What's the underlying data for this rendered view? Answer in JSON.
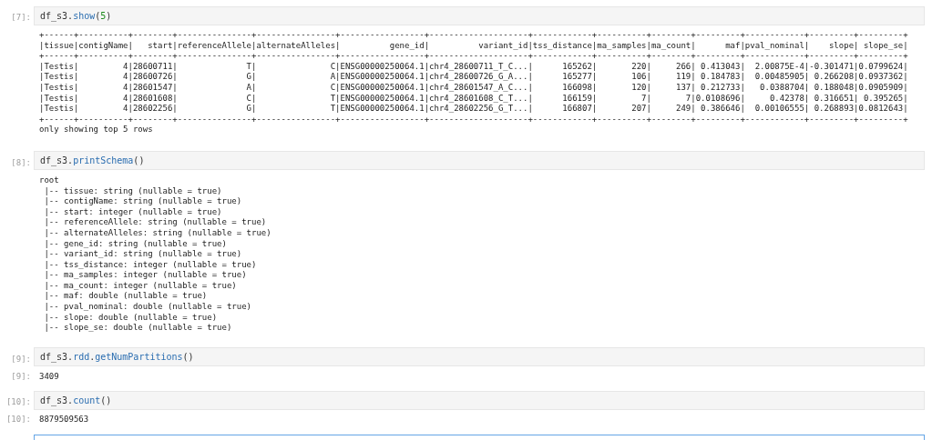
{
  "cells": [
    {
      "prompt": "[7]:",
      "code": [
        {
          "text": "df_s3.",
          "kind": "plain"
        },
        {
          "text": "show",
          "kind": "method"
        },
        {
          "text": "(",
          "kind": "plain"
        },
        {
          "text": "5",
          "kind": "number"
        },
        {
          "text": ")",
          "kind": "plain"
        }
      ],
      "output": [
        "+------+----------+--------+---------------+----------------+-----------------+--------------------+------------+----------+--------+---------+------------+---------+---------+",
        "|tissue|contigName|   start|referenceAllele|alternateAlleles|          gene_id|          variant_id|tss_distance|ma_samples|ma_count|      maf|pval_nominal|    slope| slope_se|",
        "+------+----------+--------+---------------+----------------+-----------------+--------------------+------------+----------+--------+---------+------------+---------+---------+",
        "|Testis|         4|28600711|              T|               C|ENSG00000250064.1|chr4_28600711_T_C...|      165262|       220|     266| 0.413043|  2.00875E-4|-0.301471|0.0799624|",
        "|Testis|         4|28600726|              G|               A|ENSG00000250064.1|chr4_28600726_G_A...|      165277|       106|     119| 0.184783|  0.00485905| 0.266208|0.0937362|",
        "|Testis|         4|28601547|              A|               C|ENSG00000250064.1|chr4_28601547_A_C...|      166098|       120|     137| 0.212733|   0.0388704| 0.188048|0.0905909|",
        "|Testis|         4|28601608|              C|               T|ENSG00000250064.1|chr4_28601608_C_T...|      166159|         7|       7|0.0108696|     0.42378| 0.316651| 0.395265|",
        "|Testis|         4|28602256|              G|               T|ENSG00000250064.1|chr4_28602256_G_T...|      166807|       207|     249| 0.386646|  0.00106555| 0.268893|0.0812643|",
        "+------+----------+--------+---------------+----------------+-----------------+--------------------+------------+----------+--------+---------+------------+---------+---------+",
        "only showing top 5 rows"
      ]
    },
    {
      "prompt": "[8]:",
      "code": [
        {
          "text": "df_s3.",
          "kind": "plain"
        },
        {
          "text": "printSchema",
          "kind": "method"
        },
        {
          "text": "()",
          "kind": "plain"
        }
      ],
      "output": [
        "root",
        " |-- tissue: string (nullable = true)",
        " |-- contigName: string (nullable = true)",
        " |-- start: integer (nullable = true)",
        " |-- referenceAllele: string (nullable = true)",
        " |-- alternateAlleles: string (nullable = true)",
        " |-- gene_id: string (nullable = true)",
        " |-- variant_id: string (nullable = true)",
        " |-- tss_distance: integer (nullable = true)",
        " |-- ma_samples: integer (nullable = true)",
        " |-- ma_count: integer (nullable = true)",
        " |-- maf: double (nullable = true)",
        " |-- pval_nominal: double (nullable = true)",
        " |-- slope: double (nullable = true)",
        " |-- slope_se: double (nullable = true)"
      ]
    },
    {
      "prompt": "[9]:",
      "code": [
        {
          "text": "df_s3.",
          "kind": "plain"
        },
        {
          "text": "rdd",
          "kind": "method"
        },
        {
          "text": ".",
          "kind": "plain"
        },
        {
          "text": "getNumPartitions",
          "kind": "method"
        },
        {
          "text": "()",
          "kind": "plain"
        }
      ],
      "output_prompt": "[9]:",
      "output": [
        "3409"
      ]
    },
    {
      "prompt": "[10]:",
      "code": [
        {
          "text": "df_s3.",
          "kind": "plain"
        },
        {
          "text": "count",
          "kind": "method"
        },
        {
          "text": "()",
          "kind": "plain"
        }
      ],
      "output_prompt": "[10]:",
      "output": [
        "8879509563"
      ]
    }
  ]
}
